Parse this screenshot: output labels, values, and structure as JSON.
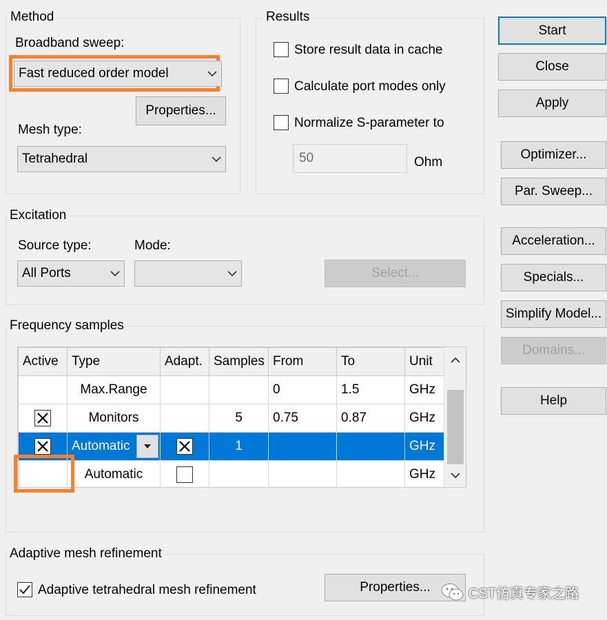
{
  "method": {
    "title": "Method",
    "broadband_label": "Broadband sweep:",
    "broadband_value": "Fast reduced order model",
    "properties_label": "Properties...",
    "mesh_type_label": "Mesh type:",
    "mesh_type_value": "Tetrahedral"
  },
  "results": {
    "title": "Results",
    "store_cache_label": "Store result data in cache",
    "store_cache_checked": false,
    "port_modes_label": "Calculate port modes only",
    "port_modes_checked": false,
    "normalize_label": "Normalize S-parameter to",
    "normalize_checked": false,
    "normalize_value": "50",
    "normalize_unit": "Ohm"
  },
  "buttons": {
    "start": "Start",
    "close": "Close",
    "apply": "Apply",
    "optimizer": "Optimizer...",
    "par_sweep": "Par. Sweep...",
    "acceleration": "Acceleration...",
    "specials": "Specials...",
    "simplify": "Simplify Model...",
    "domains": "Domains...",
    "help": "Help"
  },
  "excitation": {
    "title": "Excitation",
    "source_type_label": "Source type:",
    "source_type_value": "All Ports",
    "mode_label": "Mode:",
    "mode_value": "",
    "select_label": "Select..."
  },
  "frequency": {
    "title": "Frequency samples",
    "columns": [
      "Active",
      "Type",
      "Adapt.",
      "Samples",
      "From",
      "To",
      "Unit"
    ],
    "rows": [
      {
        "active": "none",
        "type": "Max.Range",
        "adapt": "none",
        "samples": "",
        "from": "0",
        "to": "1.5",
        "unit": "GHz",
        "selected": false
      },
      {
        "active": "checked",
        "type": "Monitors",
        "adapt": "none",
        "samples": "5",
        "from": "0.75",
        "to": "0.87",
        "unit": "GHz",
        "selected": false
      },
      {
        "active": "checked",
        "type": "Automatic",
        "adapt": "checked",
        "samples": "1",
        "from": "",
        "to": "",
        "unit": "GHz",
        "selected": true
      },
      {
        "active": "empty",
        "type": "Automatic",
        "adapt": "unchecked",
        "samples": "",
        "from": "",
        "to": "",
        "unit": "GHz",
        "selected": false
      }
    ]
  },
  "adaptive": {
    "title": "Adaptive mesh refinement",
    "checkbox_label": "Adaptive tetrahedral mesh refinement",
    "checked": true,
    "properties_label": "Properties..."
  },
  "watermark": {
    "text": "CST仿真专家之路"
  },
  "colors": {
    "highlight": "#ff7f27",
    "selection": "#0078d7"
  }
}
